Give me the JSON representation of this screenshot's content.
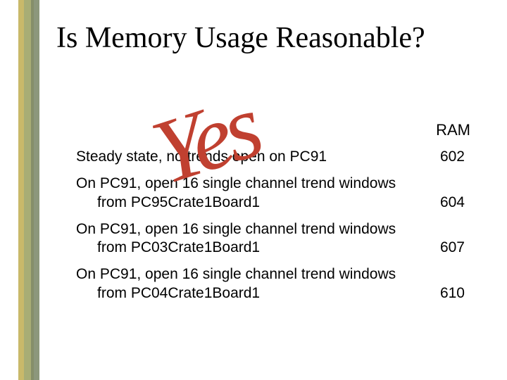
{
  "title": "Is Memory Usage Reasonable?",
  "column_header": "RAM",
  "rows": [
    {
      "desc": "Steady state, no trends open on PC91",
      "cont": "",
      "value": "602"
    },
    {
      "desc": "On PC91, open 16 single channel trend windows",
      "cont": "from PC95Crate1Board1",
      "value": "604"
    },
    {
      "desc": "On PC91, open 16 single channel trend windows",
      "cont": "from PC03Crate1Board1",
      "value": "607"
    },
    {
      "desc": "On PC91, open 16 single channel trend windows",
      "cont": "from PC04Crate1Board1",
      "value": "610"
    }
  ],
  "overlay_text": "Yes"
}
